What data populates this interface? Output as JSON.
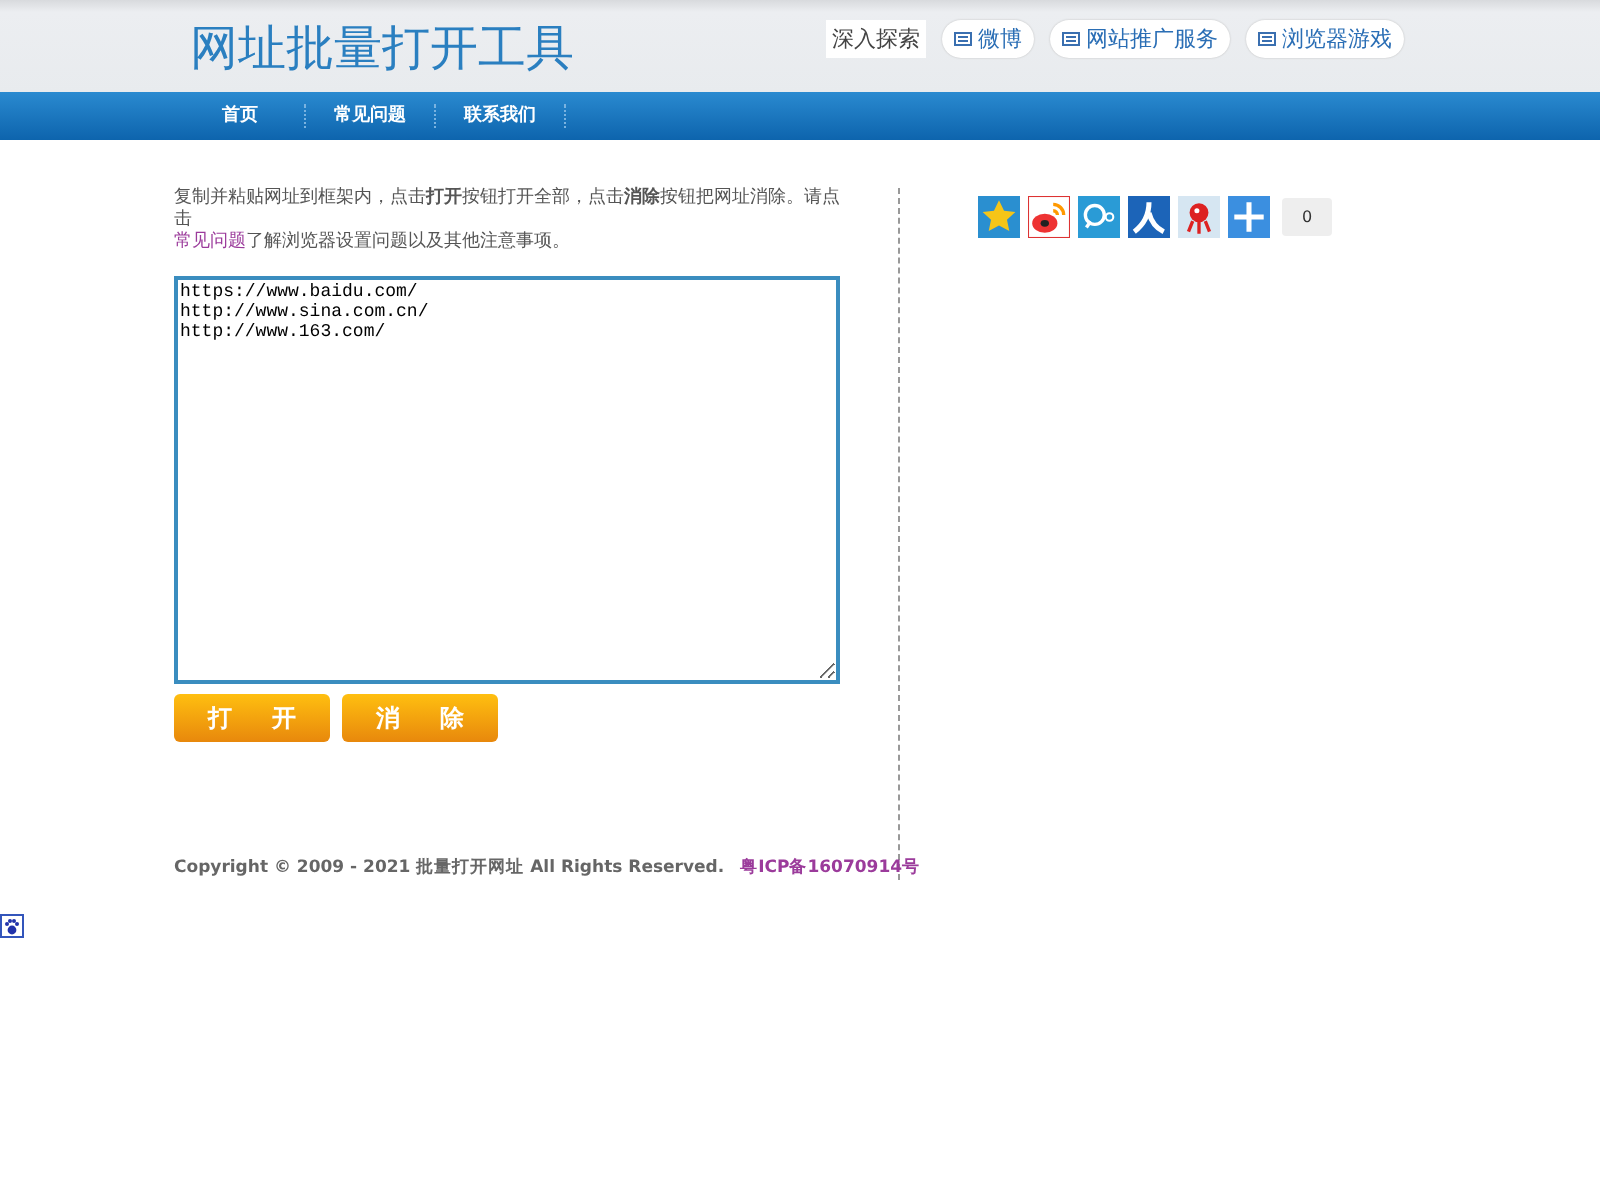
{
  "header": {
    "title": "网址批量打开工具",
    "links": [
      {
        "label": "深入探索",
        "kind": "plain"
      },
      {
        "label": "微博",
        "kind": "pill"
      },
      {
        "label": "网站推广服务",
        "kind": "pill"
      },
      {
        "label": "浏览器游戏",
        "kind": "pill"
      }
    ]
  },
  "nav": [
    {
      "label": "首页"
    },
    {
      "label": "常见问题"
    },
    {
      "label": "联系我们"
    }
  ],
  "intro": {
    "text": "复制并粘贴网址到框架内，点击**打开**按钮打开全部，点击**消除**按钮把网址消除。请点击",
    "link": "常见问题",
    "text_after": "了解浏览器设置问题以及其他注意事项。"
  },
  "urls": "https://www.baidu.com/\nhttp://www.sina.com.cn/\nhttp://www.163.com/",
  "buttons": [
    "打 开",
    "消 除"
  ],
  "share": {
    "count": "0"
  },
  "footer": {
    "copyright": "Copyright © 2009 - 2021 批量打开网址 All Rights Reserved.",
    "icp": "粤ICP备16070914号"
  }
}
